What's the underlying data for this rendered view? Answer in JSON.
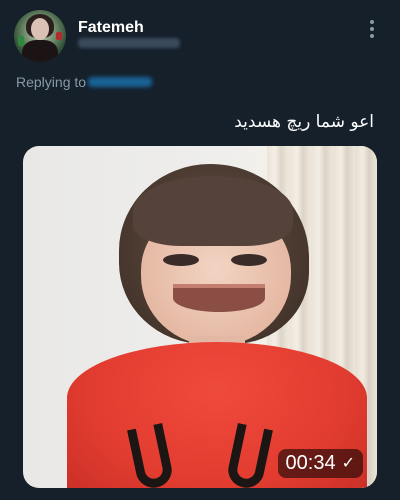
{
  "tweet": {
    "author": {
      "display_name": "Fatemeh"
    },
    "replying_to_label": "Replying to",
    "text": "اعو شما ریچ هسدید",
    "media": {
      "type": "video",
      "duration": "00:34",
      "status_icon": "checkmark-icon"
    },
    "menu_icon": "vertical-ellipsis-icon"
  },
  "colors": {
    "background": "#15202b",
    "secondary_text": "#8899a6",
    "accent": "#1d9bf0"
  }
}
